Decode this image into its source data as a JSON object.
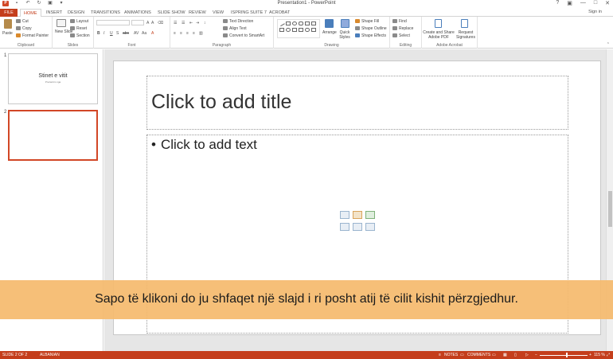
{
  "window": {
    "title": "Presentation1 - PowerPoint",
    "controls": [
      "?",
      "▣",
      "—",
      "□",
      "✕"
    ],
    "sign_in": "Sign in"
  },
  "tabs": [
    "FILE",
    "HOME",
    "INSERT",
    "DESIGN",
    "TRANSITIONS",
    "ANIMATIONS",
    "SLIDE SHOW",
    "REVIEW",
    "VIEW",
    "ISPRING SUITE 7",
    "ACROBAT"
  ],
  "ribbon": {
    "clipboard": {
      "label": "Clipboard",
      "paste": "Paste",
      "cut": "Cut",
      "copy": "Copy",
      "format_painter": "Format Painter"
    },
    "slides": {
      "label": "Slides",
      "new_slide": "New Slide",
      "layout": "Layout",
      "reset": "Reset",
      "section": "Section"
    },
    "font": {
      "label": "Font"
    },
    "paragraph": {
      "label": "Paragraph",
      "text_direction": "Text Direction",
      "align_text": "Align Text",
      "convert_smartart": "Convert to SmartArt"
    },
    "drawing": {
      "label": "Drawing",
      "arrange": "Arrange",
      "quick_styles": "Quick Styles",
      "shape_fill": "Shape Fill",
      "shape_outline": "Shape Outline",
      "shape_effects": "Shape Effects"
    },
    "editing": {
      "label": "Editing",
      "find": "Find",
      "replace": "Replace",
      "select": "Select"
    },
    "acrobat": {
      "label": "Adobe Acrobat",
      "create_share": "Create and Share Adobe PDF",
      "request_signatures": "Request Signatures"
    }
  },
  "slides_panel": [
    {
      "number": "1",
      "title": "Stinet e vitit",
      "subtitle": "Prezantim nga"
    },
    {
      "number": "2",
      "title": "",
      "subtitle": ""
    }
  ],
  "slide": {
    "title_placeholder": "Click to add title",
    "body_placeholder": "Click to add text",
    "bullet": "•"
  },
  "caption": "Sapo të klikoni do ju shfaqet një slajd i ri posht atij të cilit kishit përzgjedhur.",
  "statusbar": {
    "slide_info": "SLIDE 2 OF 2",
    "language": "ALBANIAN",
    "notes": "NOTES",
    "comments": "COMMENTS",
    "zoom": "115 %"
  },
  "colors": {
    "accent": "#c43e1c",
    "caption_bg": "#f5ba6e"
  }
}
